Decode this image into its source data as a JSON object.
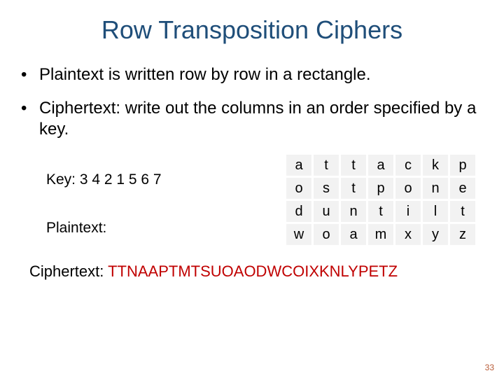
{
  "title": "Row Transposition Ciphers",
  "bullets": [
    "Plaintext is written row by row in a rectangle.",
    "Ciphertext: write out the columns in an order specified by a key."
  ],
  "key_label": "Key: 3 4 2 1 5 6 7",
  "plaintext_label": "Plaintext:",
  "grid": [
    [
      "a",
      "t",
      "t",
      "a",
      "c",
      "k",
      "p"
    ],
    [
      "o",
      "s",
      "t",
      "p",
      "o",
      "n",
      "e"
    ],
    [
      "d",
      "u",
      "n",
      "t",
      "i",
      "l",
      "t"
    ],
    [
      "w",
      "o",
      "a",
      "m",
      "x",
      "y",
      "z"
    ]
  ],
  "ciphertext_label": "Ciphertext: ",
  "ciphertext_value": "TTNAAPTMTSUOAODWCOIXKNLYPETZ",
  "page_number": "33"
}
